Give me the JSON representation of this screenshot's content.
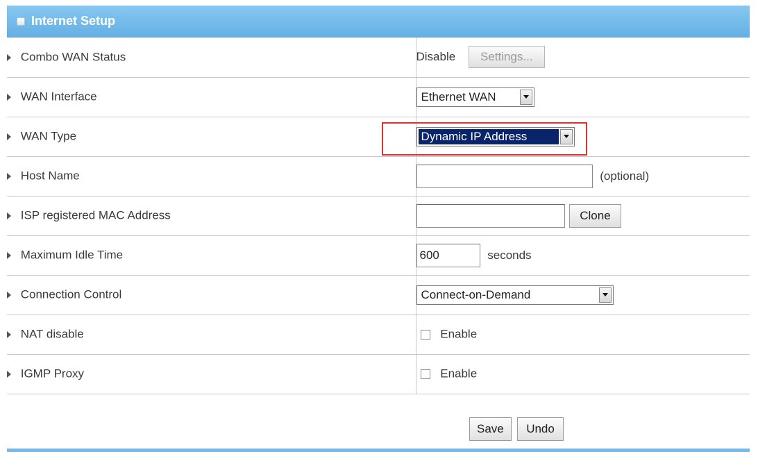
{
  "panel": {
    "title": "Internet Setup"
  },
  "rows": {
    "combo_wan_status": {
      "label": "Combo WAN Status",
      "value": "Disable",
      "settings_button": "Settings..."
    },
    "wan_interface": {
      "label": "WAN Interface",
      "selected": "Ethernet WAN"
    },
    "wan_type": {
      "label": "WAN Type",
      "selected": "Dynamic IP Address"
    },
    "host_name": {
      "label": "Host Name",
      "value": "",
      "hint": "(optional)"
    },
    "isp_mac": {
      "label": "ISP registered MAC Address",
      "value": "",
      "clone_button": "Clone"
    },
    "max_idle": {
      "label": "Maximum Idle Time",
      "value": "600",
      "unit": "seconds"
    },
    "connection_control": {
      "label": "Connection Control",
      "selected": "Connect-on-Demand"
    },
    "nat_disable": {
      "label": "NAT disable",
      "checkbox_label": "Enable",
      "checked": false
    },
    "igmp_proxy": {
      "label": "IGMP Proxy",
      "checkbox_label": "Enable",
      "checked": false
    }
  },
  "footer": {
    "save_label": "Save",
    "undo_label": "Undo"
  },
  "colors": {
    "header": "#6ab4e8",
    "highlight_box": "#e03030",
    "selection": "#0a246a"
  }
}
